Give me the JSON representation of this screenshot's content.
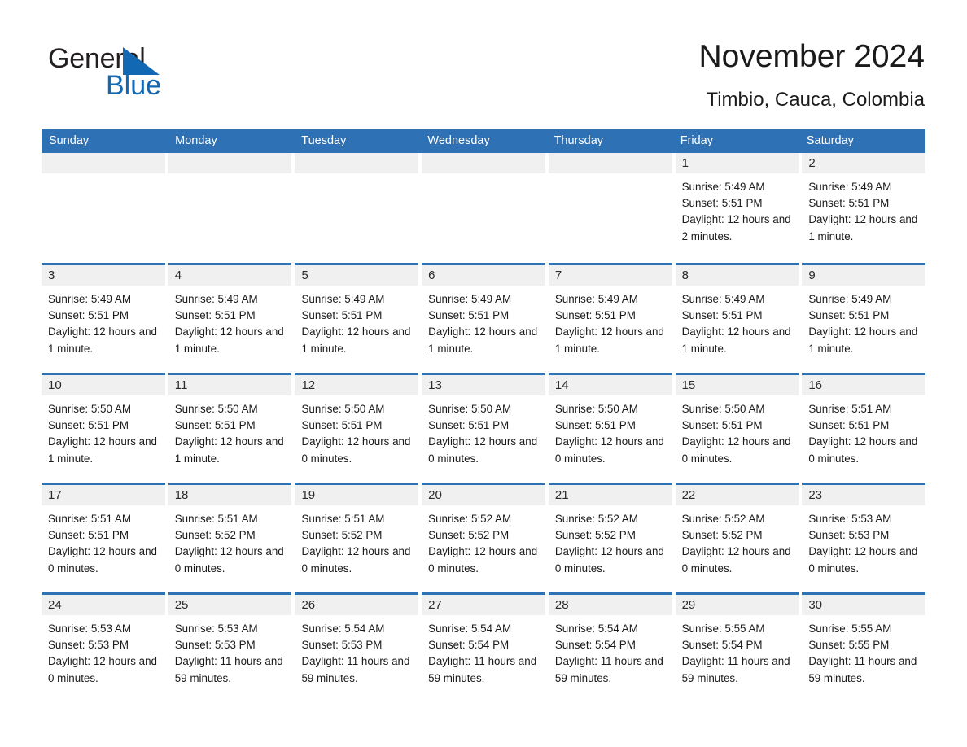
{
  "brand": {
    "name_part1": "General",
    "name_part2": "Blue",
    "triangle_color": "#1268b3",
    "text_color": "#231f20"
  },
  "header": {
    "month_title": "November 2024",
    "location": "Timbio, Cauca, Colombia"
  },
  "theme": {
    "header_blue": "#2e71b5",
    "daynum_strip": "#f0f0f0",
    "cell_background": "#ffffff",
    "text": "#1a1a1a"
  },
  "weekdays": [
    "Sunday",
    "Monday",
    "Tuesday",
    "Wednesday",
    "Thursday",
    "Friday",
    "Saturday"
  ],
  "weeks": [
    [
      {
        "day": "",
        "empty": true
      },
      {
        "day": "",
        "empty": true
      },
      {
        "day": "",
        "empty": true
      },
      {
        "day": "",
        "empty": true
      },
      {
        "day": "",
        "empty": true
      },
      {
        "day": "1",
        "sunrise": "Sunrise: 5:49 AM",
        "sunset": "Sunset: 5:51 PM",
        "daylight": "Daylight: 12 hours and 2 minutes."
      },
      {
        "day": "2",
        "sunrise": "Sunrise: 5:49 AM",
        "sunset": "Sunset: 5:51 PM",
        "daylight": "Daylight: 12 hours and 1 minute."
      }
    ],
    [
      {
        "day": "3",
        "sunrise": "Sunrise: 5:49 AM",
        "sunset": "Sunset: 5:51 PM",
        "daylight": "Daylight: 12 hours and 1 minute."
      },
      {
        "day": "4",
        "sunrise": "Sunrise: 5:49 AM",
        "sunset": "Sunset: 5:51 PM",
        "daylight": "Daylight: 12 hours and 1 minute."
      },
      {
        "day": "5",
        "sunrise": "Sunrise: 5:49 AM",
        "sunset": "Sunset: 5:51 PM",
        "daylight": "Daylight: 12 hours and 1 minute."
      },
      {
        "day": "6",
        "sunrise": "Sunrise: 5:49 AM",
        "sunset": "Sunset: 5:51 PM",
        "daylight": "Daylight: 12 hours and 1 minute."
      },
      {
        "day": "7",
        "sunrise": "Sunrise: 5:49 AM",
        "sunset": "Sunset: 5:51 PM",
        "daylight": "Daylight: 12 hours and 1 minute."
      },
      {
        "day": "8",
        "sunrise": "Sunrise: 5:49 AM",
        "sunset": "Sunset: 5:51 PM",
        "daylight": "Daylight: 12 hours and 1 minute."
      },
      {
        "day": "9",
        "sunrise": "Sunrise: 5:49 AM",
        "sunset": "Sunset: 5:51 PM",
        "daylight": "Daylight: 12 hours and 1 minute."
      }
    ],
    [
      {
        "day": "10",
        "sunrise": "Sunrise: 5:50 AM",
        "sunset": "Sunset: 5:51 PM",
        "daylight": "Daylight: 12 hours and 1 minute."
      },
      {
        "day": "11",
        "sunrise": "Sunrise: 5:50 AM",
        "sunset": "Sunset: 5:51 PM",
        "daylight": "Daylight: 12 hours and 1 minute."
      },
      {
        "day": "12",
        "sunrise": "Sunrise: 5:50 AM",
        "sunset": "Sunset: 5:51 PM",
        "daylight": "Daylight: 12 hours and 0 minutes."
      },
      {
        "day": "13",
        "sunrise": "Sunrise: 5:50 AM",
        "sunset": "Sunset: 5:51 PM",
        "daylight": "Daylight: 12 hours and 0 minutes."
      },
      {
        "day": "14",
        "sunrise": "Sunrise: 5:50 AM",
        "sunset": "Sunset: 5:51 PM",
        "daylight": "Daylight: 12 hours and 0 minutes."
      },
      {
        "day": "15",
        "sunrise": "Sunrise: 5:50 AM",
        "sunset": "Sunset: 5:51 PM",
        "daylight": "Daylight: 12 hours and 0 minutes."
      },
      {
        "day": "16",
        "sunrise": "Sunrise: 5:51 AM",
        "sunset": "Sunset: 5:51 PM",
        "daylight": "Daylight: 12 hours and 0 minutes."
      }
    ],
    [
      {
        "day": "17",
        "sunrise": "Sunrise: 5:51 AM",
        "sunset": "Sunset: 5:51 PM",
        "daylight": "Daylight: 12 hours and 0 minutes."
      },
      {
        "day": "18",
        "sunrise": "Sunrise: 5:51 AM",
        "sunset": "Sunset: 5:52 PM",
        "daylight": "Daylight: 12 hours and 0 minutes."
      },
      {
        "day": "19",
        "sunrise": "Sunrise: 5:51 AM",
        "sunset": "Sunset: 5:52 PM",
        "daylight": "Daylight: 12 hours and 0 minutes."
      },
      {
        "day": "20",
        "sunrise": "Sunrise: 5:52 AM",
        "sunset": "Sunset: 5:52 PM",
        "daylight": "Daylight: 12 hours and 0 minutes."
      },
      {
        "day": "21",
        "sunrise": "Sunrise: 5:52 AM",
        "sunset": "Sunset: 5:52 PM",
        "daylight": "Daylight: 12 hours and 0 minutes."
      },
      {
        "day": "22",
        "sunrise": "Sunrise: 5:52 AM",
        "sunset": "Sunset: 5:52 PM",
        "daylight": "Daylight: 12 hours and 0 minutes."
      },
      {
        "day": "23",
        "sunrise": "Sunrise: 5:53 AM",
        "sunset": "Sunset: 5:53 PM",
        "daylight": "Daylight: 12 hours and 0 minutes."
      }
    ],
    [
      {
        "day": "24",
        "sunrise": "Sunrise: 5:53 AM",
        "sunset": "Sunset: 5:53 PM",
        "daylight": "Daylight: 12 hours and 0 minutes."
      },
      {
        "day": "25",
        "sunrise": "Sunrise: 5:53 AM",
        "sunset": "Sunset: 5:53 PM",
        "daylight": "Daylight: 11 hours and 59 minutes."
      },
      {
        "day": "26",
        "sunrise": "Sunrise: 5:54 AM",
        "sunset": "Sunset: 5:53 PM",
        "daylight": "Daylight: 11 hours and 59 minutes."
      },
      {
        "day": "27",
        "sunrise": "Sunrise: 5:54 AM",
        "sunset": "Sunset: 5:54 PM",
        "daylight": "Daylight: 11 hours and 59 minutes."
      },
      {
        "day": "28",
        "sunrise": "Sunrise: 5:54 AM",
        "sunset": "Sunset: 5:54 PM",
        "daylight": "Daylight: 11 hours and 59 minutes."
      },
      {
        "day": "29",
        "sunrise": "Sunrise: 5:55 AM",
        "sunset": "Sunset: 5:54 PM",
        "daylight": "Daylight: 11 hours and 59 minutes."
      },
      {
        "day": "30",
        "sunrise": "Sunrise: 5:55 AM",
        "sunset": "Sunset: 5:55 PM",
        "daylight": "Daylight: 11 hours and 59 minutes."
      }
    ]
  ]
}
